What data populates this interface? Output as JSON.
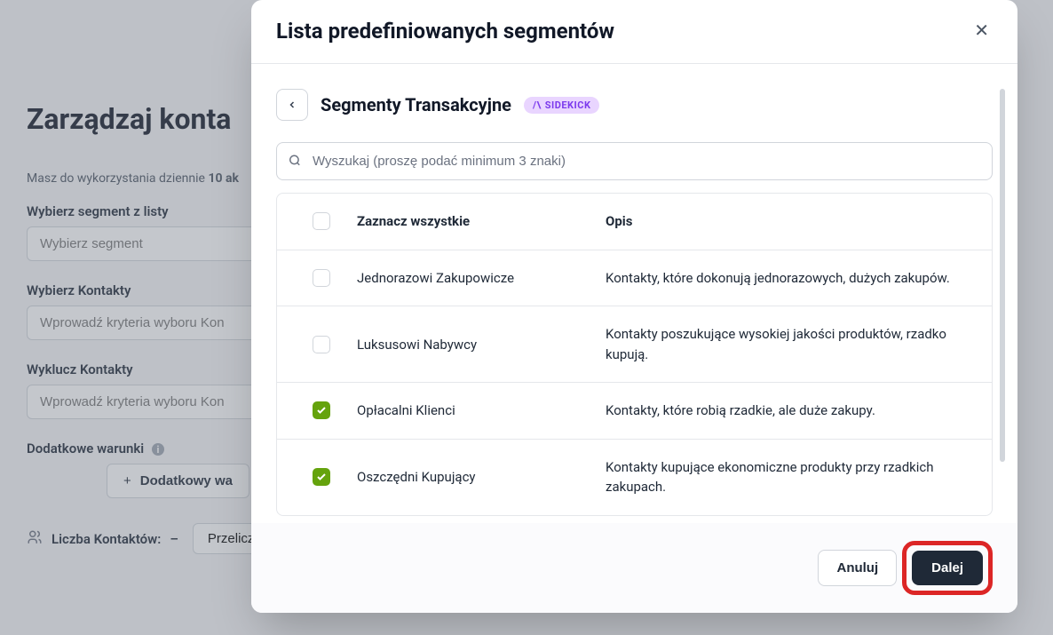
{
  "background": {
    "title": "Zarządzaj konta",
    "usage_prefix": "Masz do wykorzystania dziennie ",
    "usage_count": "10 ak",
    "select_segment_label": "Wybierz segment z listy",
    "select_segment_placeholder": "Wybierz segment",
    "select_contacts_label": "Wybierz Kontakty",
    "select_contacts_placeholder": "Wprowadź kryteria wyboru Kon",
    "exclude_contacts_label": "Wyklucz Kontakty",
    "exclude_contacts_placeholder": "Wprowadź kryteria wyboru Kon",
    "extra_conditions_label": "Dodatkowe warunki",
    "add_condition_btn": "Dodatkowy wa",
    "contacts_count_label": "Liczba Kontaktów:",
    "contacts_count_value": "–",
    "recalc_btn": "Przelicz"
  },
  "modal": {
    "title": "Lista predefiniowanych segmentów",
    "segment_title": "Segmenty Transakcyjne",
    "sidekick_badge": "SIDEKICK",
    "search_placeholder": "Wyszukaj (proszę podać minimum 3 znaki)",
    "header_name": "Zaznacz wszystkie",
    "header_desc": "Opis",
    "rows": [
      {
        "name": "Jednorazowi Zakupowicze",
        "desc": "Kontakty, które dokonują jednorazowych, dużych zakupów.",
        "checked": false
      },
      {
        "name": "Luksusowi Nabywcy",
        "desc": "Kontakty poszukujące wysokiej jakości produktów, rzadko kupują.",
        "checked": false
      },
      {
        "name": "Opłacalni Klienci",
        "desc": "Kontakty, które robią rzadkie, ale duże zakupy.",
        "checked": true
      },
      {
        "name": "Oszczędni Kupujący",
        "desc": "Kontakty kupujące ekonomiczne produkty przy rzadkich zakupach.",
        "checked": true
      }
    ],
    "cancel_btn": "Anuluj",
    "next_btn": "Dalej"
  }
}
